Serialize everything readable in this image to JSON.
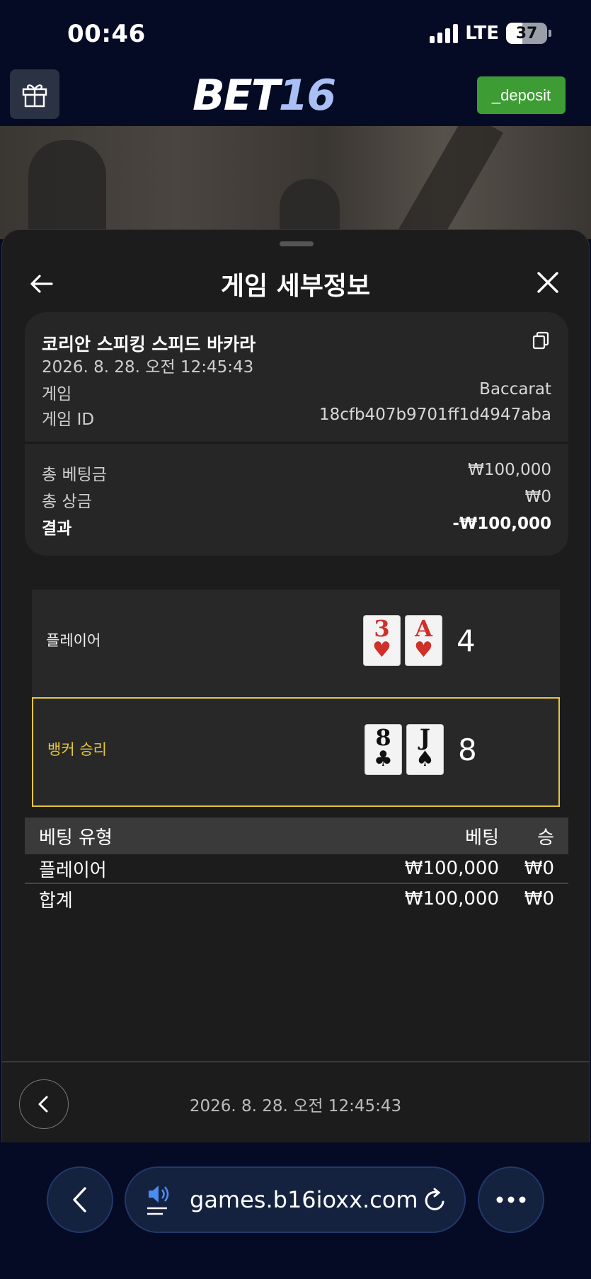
{
  "status_bar": {
    "time": "00:46",
    "network": "LTE",
    "battery": "37"
  },
  "header": {
    "logo_part1": "BET",
    "logo_part2": "16",
    "deposit_label": "_deposit"
  },
  "sheet": {
    "title": "게임 세부정보",
    "info": {
      "game_name": "코리안 스피킹 스피드 바카라",
      "datetime": "2026. 8. 28. 오전 12:45:43",
      "game_label": "게임",
      "game_value": "Baccarat",
      "game_id_label": "게임 ID",
      "game_id_value": "18cfb407b9701ff1d4947aba",
      "total_bet_label": "총 베팅금",
      "total_bet_value": "₩100,000",
      "total_win_label": "총 상금",
      "total_win_value": "₩0",
      "result_label": "결과",
      "result_value": "-₩100,000"
    },
    "player": {
      "label": "플레이어",
      "cards": [
        {
          "rank": "3",
          "suit": "♥",
          "color": "red"
        },
        {
          "rank": "A",
          "suit": "♥",
          "color": "red"
        }
      ],
      "score": "4"
    },
    "banker": {
      "label": "뱅커 승리",
      "cards": [
        {
          "rank": "8",
          "suit": "♣",
          "color": "black"
        },
        {
          "rank": "J",
          "suit": "♠",
          "color": "black"
        }
      ],
      "score": "8"
    },
    "bets_table": {
      "headers": [
        "베팅 유형",
        "베팅",
        "승"
      ],
      "rows": [
        [
          "플레이어",
          "₩100,000",
          "₩0"
        ]
      ],
      "total": [
        "합계",
        "₩100,000",
        "₩0"
      ]
    },
    "footer_datetime": "2026. 8. 28. 오전 12:45:43"
  },
  "browser": {
    "url": "games.b16ioxx.com"
  },
  "colors": {
    "deposit": "#3e9c35",
    "winner_highlight": "#e5c63c",
    "background": "#050b25"
  }
}
